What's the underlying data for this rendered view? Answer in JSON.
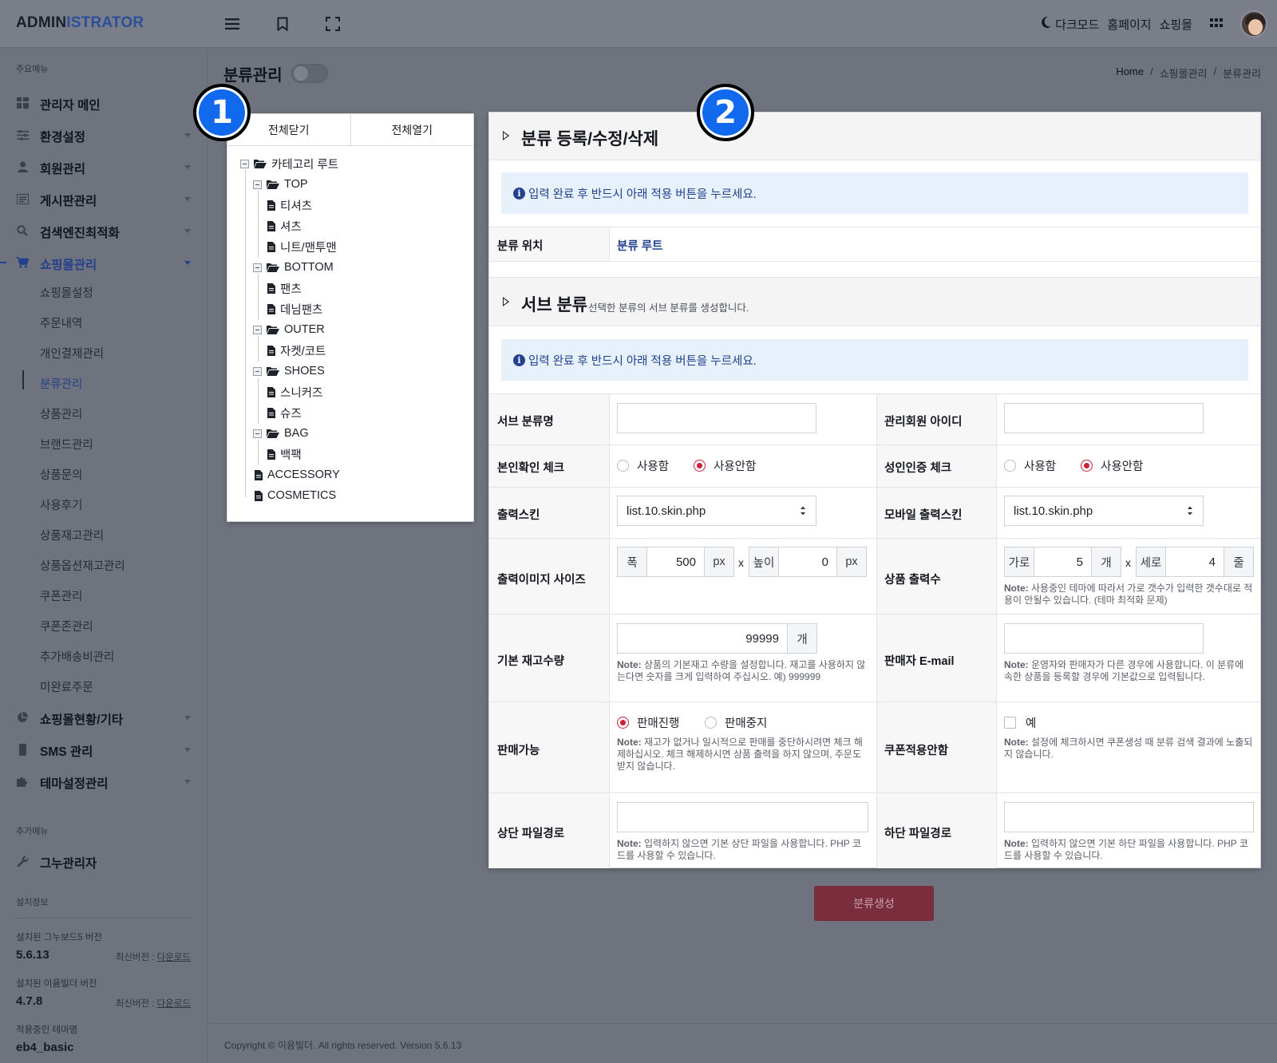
{
  "header": {
    "logo_main": "ADMIN",
    "logo_accent": "ISTRATOR",
    "darkmode_label": "다크모드",
    "homepage_label": "홈페이지",
    "shop_label": "쇼핑몰"
  },
  "sidebar": {
    "main_section_title": "주요메뉴",
    "menu": [
      {
        "label": "관리자 메인",
        "icon": "dashboard-icon"
      },
      {
        "label": "환경설정",
        "icon": "sliders-icon"
      },
      {
        "label": "회원관리",
        "icon": "user-icon"
      },
      {
        "label": "게시판관리",
        "icon": "board-icon"
      },
      {
        "label": "검색엔진최적화",
        "icon": "search-icon"
      },
      {
        "label": "쇼핑몰관리",
        "icon": "cart-icon"
      }
    ],
    "shop_sub": [
      "쇼핑몰설정",
      "주문내역",
      "개인결제관리",
      "분류관리",
      "상품관리",
      "브랜드관리",
      "상품문의",
      "사용후기",
      "상품재고관리",
      "상품옵션재고관리",
      "쿠폰관리",
      "쿠폰존관리",
      "추가배송비관리",
      "미완료주문"
    ],
    "menu_after": [
      {
        "label": "쇼핑몰현황/기타",
        "icon": "pie-chart-icon"
      },
      {
        "label": "SMS 관리",
        "icon": "mobile-icon"
      },
      {
        "label": "테마설정관리",
        "icon": "puzzle-icon"
      }
    ],
    "extra_section_title": "추가메뉴",
    "extra_item": "그누관리자",
    "install_section_title": "설치정보",
    "gnuboard_label": "설치된 그누보드5 버전",
    "gnuboard_version": "5.6.13",
    "eyoom_label": "설치된 이윰빌더 버전",
    "eyoom_version": "4.7.8",
    "latest_prefix": "최신버전 : ",
    "download_label": "다운로드",
    "theme_label": "적용중인 테마명",
    "theme_value": "eb4_basic"
  },
  "page": {
    "title": "분류관리",
    "breadcrumb": [
      "Home",
      "/",
      "쇼핑몰관리",
      "/",
      "분류관리"
    ]
  },
  "tree": {
    "collapse_all": "전체닫기",
    "expand_all": "전체열기",
    "root": "카테고리 루트",
    "groups": [
      {
        "name": "TOP",
        "children": [
          "티셔츠",
          "셔츠",
          "니트/맨투맨"
        ]
      },
      {
        "name": "BOTTOM",
        "children": [
          "팬츠",
          "데님팬츠"
        ]
      },
      {
        "name": "OUTER",
        "children": [
          "자켓/코트"
        ]
      },
      {
        "name": "SHOES",
        "children": [
          "스니커즈",
          "슈즈"
        ]
      },
      {
        "name": "BAG",
        "children": [
          "백팩"
        ]
      }
    ],
    "leaves": [
      "ACCESSORY",
      "COSMETICS"
    ]
  },
  "form": {
    "section1_title": "분류 등록/수정/삭제",
    "info_text": "입력 완료 후 반드시 아래 적용 버튼을 누르세요.",
    "location_label": "분류 위치",
    "location_value": "분류 루트",
    "section2_title": "서브 분류",
    "section2_desc": "선택한 분류의 서브 분류를 생성합니다.",
    "sub_name_label": "서브 분류명",
    "admin_id_label": "관리회원 아이디",
    "identity_label": "본인확인 체크",
    "adult_label": "성인인증 체크",
    "use_label": "사용함",
    "nouse_label": "사용안함",
    "skin_label": "출력스킨",
    "mobile_skin_label": "모바일 출력스킨",
    "skin_value": "list.10.skin.php",
    "mobile_skin_value": "list.10.skin.php",
    "image_size_label": "출력이미지 사이즈",
    "width_label": "폭",
    "width_value": "500",
    "height_label": "높이",
    "height_value": "0",
    "px": "px",
    "x": "x",
    "product_count_label": "상품 출력수",
    "cols_label": "가로",
    "cols_value": "5",
    "cols_unit": "개",
    "rows_label": "세로",
    "rows_value": "4",
    "rows_unit": "줄",
    "count_note_bold": "Note:",
    "count_note": "사용중인 테마에 따라서 가로 갯수가 입력한 갯수대로 적용이 안될수 있습니다. (테마 최적화 문제)",
    "stock_label": "기본 재고수량",
    "stock_value": "99999",
    "stock_unit": "개",
    "stock_note": "상품의 기본재고 수량을 설정합니다. 재고를 사용하지 않는다면 숫자를 크게 입력하여 주십시오. 예) 999999",
    "seller_email_label": "판매자 E-mail",
    "email_note": "운영자와 판매자가 다른 경우에 사용합니다. 이 분류에 속한 상품을 등록할 경우에 기본값으로 입력됩니다.",
    "sale_label": "판매가능",
    "sale_on": "판매진행",
    "sale_off": "판매중지",
    "sale_note": "재고가 없거나 일시적으로 판매를 중단하시려면 체크 해제하십시오. 체크 해제하시면 상품 출력을 하지 않으며, 주문도 받지 않습니다.",
    "coupon_label": "쿠폰적용안함",
    "coupon_check": "예",
    "coupon_note": "설정에 체크하시면 쿠폰생성 때 분류 검색 결과에 노출되지 않습니다.",
    "top_file_label": "상단 파일경로",
    "top_file_note": "입력하지 않으면 기본 상단 파일을 사용합니다. PHP 코드를 사용할 수 있습니다.",
    "bottom_file_label": "하단 파일경로",
    "bottom_file_note": "입력하지 않으면 기본 하단 파일을 사용합니다. PHP 코드를 사용할 수 있습니다.",
    "submit_label": "분류생성"
  },
  "badges": [
    "1",
    "2"
  ],
  "footer": {
    "text": "Copyright © 이윰빌더. All rights reserved. Version 5.6.13"
  },
  "colors": {
    "accent": "#24408c",
    "radio_on": "#d11f3a",
    "submit": "#7a2d3c",
    "badge": "#1169ee"
  }
}
